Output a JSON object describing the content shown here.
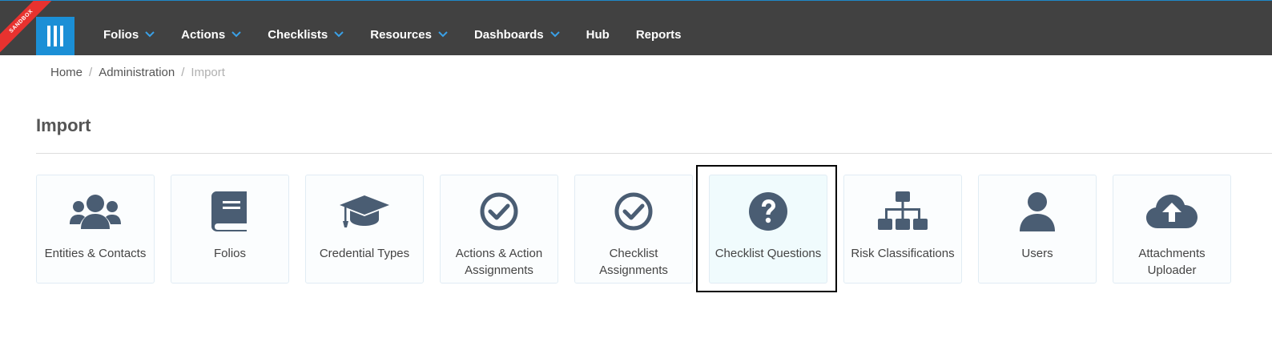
{
  "app": {
    "environment_badge": "SANDBOX"
  },
  "nav": {
    "items": [
      {
        "label": "Folios",
        "has_dropdown": true
      },
      {
        "label": "Actions",
        "has_dropdown": true
      },
      {
        "label": "Checklists",
        "has_dropdown": true
      },
      {
        "label": "Resources",
        "has_dropdown": true
      },
      {
        "label": "Dashboards",
        "has_dropdown": true
      },
      {
        "label": "Hub",
        "has_dropdown": false
      },
      {
        "label": "Reports",
        "has_dropdown": false
      }
    ]
  },
  "breadcrumb": {
    "home": "Home",
    "section": "Administration",
    "current": "Import"
  },
  "page": {
    "title": "Import"
  },
  "tiles": [
    {
      "label": "Entities & Contacts",
      "icon": "users-icon"
    },
    {
      "label": "Folios",
      "icon": "book-icon"
    },
    {
      "label": "Credential Types",
      "icon": "graduation-cap-icon"
    },
    {
      "label": "Actions & Action Assignments",
      "icon": "check-circle-icon"
    },
    {
      "label": "Checklist Assignments",
      "icon": "check-circle-icon"
    },
    {
      "label": "Checklist Questions",
      "icon": "question-circle-icon",
      "selected": true
    },
    {
      "label": "Risk Classifications",
      "icon": "sitemap-icon"
    },
    {
      "label": "Users",
      "icon": "user-icon"
    },
    {
      "label": "Attachments Uploader",
      "icon": "cloud-upload-icon"
    }
  ],
  "colors": {
    "topbar": "#414141",
    "accent": "#1b8fd6",
    "icon": "#4a5d73",
    "badge": "#e8322f"
  }
}
